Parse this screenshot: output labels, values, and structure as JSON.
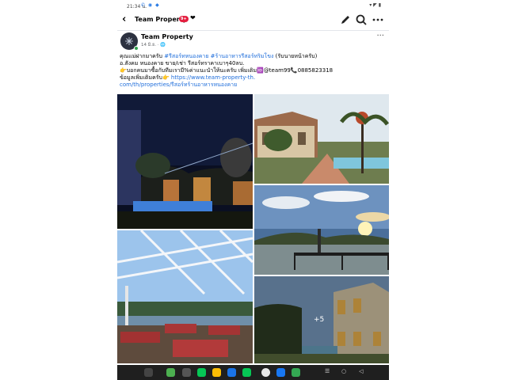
{
  "status_bar": {
    "time": "21:34 น.",
    "right_icons": "▾ ◤ ▮"
  },
  "header": {
    "back_label": "‹",
    "title": "Team Property",
    "badge": "9+",
    "heart_symbol": "❤"
  },
  "post": {
    "page_name": "Team Property",
    "meta": "14 มิ.ย. · 🌐",
    "more_label": "···",
    "lines": [
      {
        "text": "คุณแม่ฝากมาครับ ",
        "tag1": "#รีสอร์ทหนองคาย",
        "tag2": " #ร้านอาหารรีสอร์ทริมโขง",
        "suffix": " (รับนายหน้าครับ)"
      },
      {
        "text": "อ.สังคม หนองคาย ขาย/เช่า รีสอร์ทราคาเบาๆ40ลบ."
      },
      {
        "text": "👉บอกคนมาซื้อกับทีมเรามี%ค่าแนะนำให้นะครับ เพิ่มเติม🆔@team99📞0885823318"
      },
      {
        "text": "ข้อมูลเพิ่มเติมครับ👉 ",
        "link": "https://www.team-property-th."
      },
      {
        "link": "com/th/properties/รีสอร์ทร้านอาหารหนองคาย"
      }
    ],
    "more_photos": "+5"
  },
  "nav_apps": [
    "app-grid",
    "chat",
    "camera",
    "line",
    "files",
    "messages",
    "line-2",
    "chrome",
    "facebook",
    "maps"
  ],
  "sys_buttons": {
    "menu": "☰",
    "home": "○",
    "back": "◁"
  }
}
